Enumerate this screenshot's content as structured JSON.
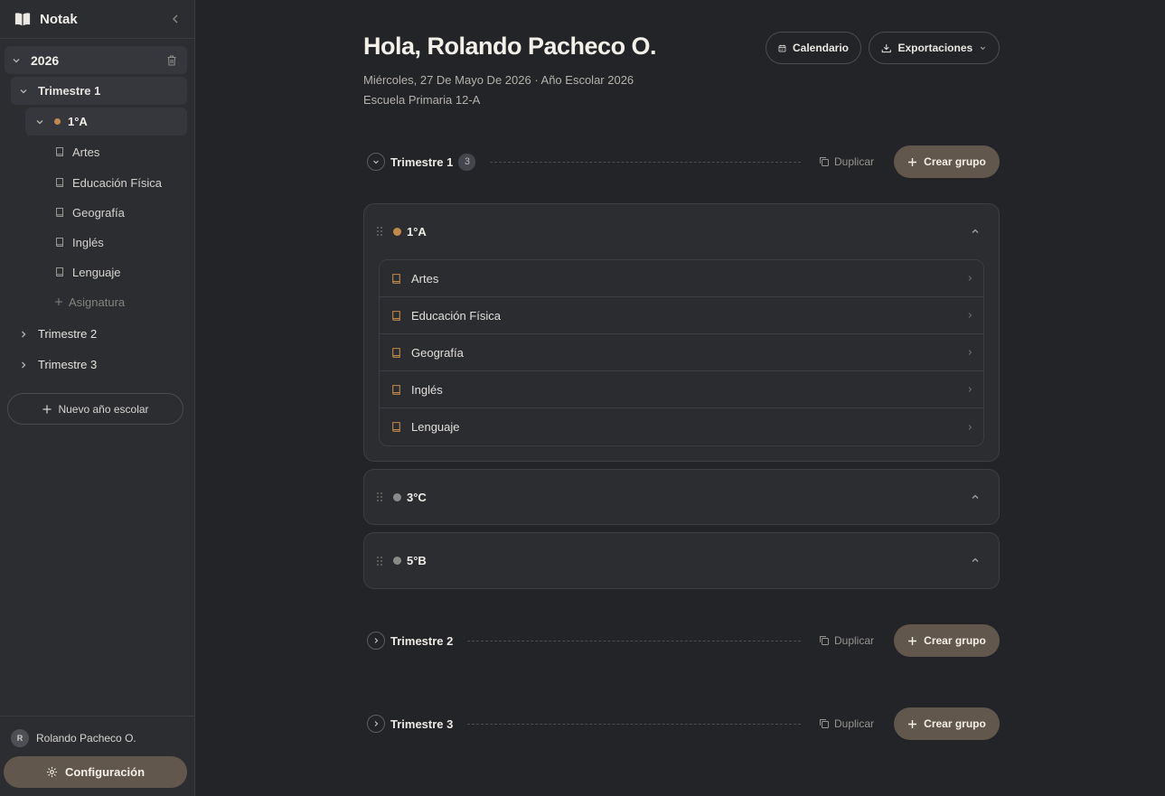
{
  "app": {
    "name": "Notak"
  },
  "sidebar": {
    "year": "2026",
    "terms": [
      {
        "label": "Trimestre 1",
        "expanded": true
      },
      {
        "label": "Trimestre 2",
        "expanded": false
      },
      {
        "label": "Trimestre 3",
        "expanded": false
      }
    ],
    "active_group": {
      "label": "1°A",
      "color": "#c28a4a"
    },
    "subjects": [
      "Artes",
      "Educación Física",
      "Geografía",
      "Inglés",
      "Lenguaje"
    ],
    "add_subject_label": "Asignatura",
    "new_year_label": "Nuevo año escolar",
    "user": {
      "initial": "R",
      "name": "Rolando Pacheco O."
    },
    "config_label": "Configuración"
  },
  "header": {
    "greeting": "Hola, Rolando Pacheco O.",
    "date_line": "Miércoles, 27 De Mayo De 2026 · Año Escolar 2026",
    "school": "Escuela Primaria 12-A",
    "calendar_label": "Calendario",
    "exports_label": "Exportaciones"
  },
  "terms": [
    {
      "title": "Trimestre 1",
      "count": "3",
      "duplicate_label": "Duplicar",
      "create_label": "Crear grupo",
      "groups": [
        {
          "name": "1°A",
          "color": "#c28a4a",
          "expanded": true,
          "subjects": [
            "Artes",
            "Educación Física",
            "Geografía",
            "Inglés",
            "Lenguaje"
          ]
        },
        {
          "name": "3°C",
          "color": "#8a8a8a",
          "expanded": false
        },
        {
          "name": "5°B",
          "color": "#8a8a8a",
          "expanded": false
        }
      ]
    },
    {
      "title": "Trimestre 2",
      "duplicate_label": "Duplicar",
      "create_label": "Crear grupo"
    },
    {
      "title": "Trimestre 3",
      "duplicate_label": "Duplicar",
      "create_label": "Crear grupo"
    }
  ]
}
